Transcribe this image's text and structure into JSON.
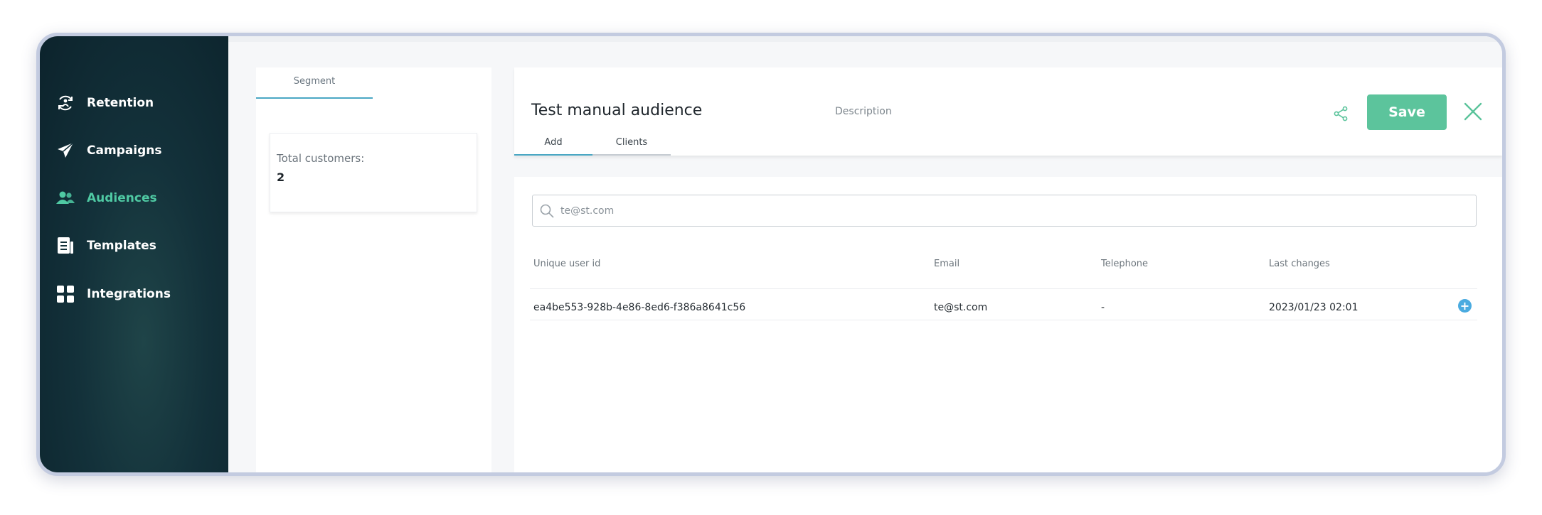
{
  "sidebar": {
    "items": [
      {
        "label": "Retention",
        "icon": "retention-icon"
      },
      {
        "label": "Campaigns",
        "icon": "paper-plane-icon"
      },
      {
        "label": "Audiences",
        "icon": "users-icon",
        "active": true
      },
      {
        "label": "Templates",
        "icon": "document-icon"
      },
      {
        "label": "Integrations",
        "icon": "grid-icon"
      }
    ]
  },
  "left_panel": {
    "tab_label": "Segment",
    "total_label": "Total customers:",
    "total_value": "2"
  },
  "header": {
    "title": "Test manual audience",
    "description_placeholder": "Description",
    "save_label": "Save",
    "tabs": [
      {
        "label": "Add",
        "active": true
      },
      {
        "label": "Clients",
        "active": false
      }
    ]
  },
  "search": {
    "value": "te@st.com"
  },
  "table": {
    "columns": [
      "Unique user id",
      "Email",
      "Telephone",
      "Last changes"
    ],
    "rows": [
      {
        "unique_user_id": "ea4be553-928b-4e86-8ed6-f386a8641c56",
        "email": "te@st.com",
        "telephone": "-",
        "last_changes": "2023/01/23 02:01"
      }
    ]
  },
  "colors": {
    "accent_green": "#5cc49c",
    "active_nav": "#4fc9a3",
    "tab_underline": "#4aa7c4",
    "sidebar_bg": "#13313a",
    "add_button": "#4aabe0"
  }
}
